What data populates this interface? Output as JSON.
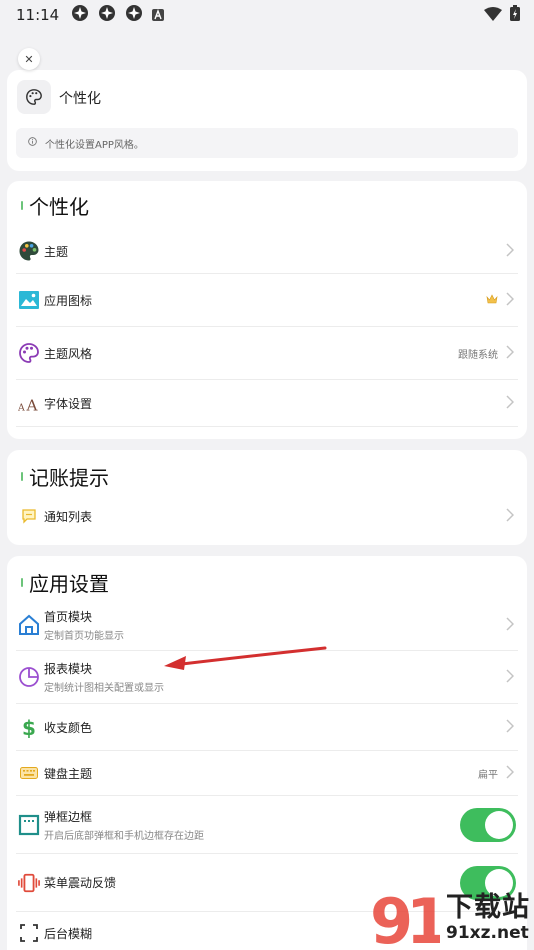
{
  "status_bar": {
    "time": "11:14"
  },
  "header": {
    "title": "个性化",
    "tip": "个性化设置APP风格。"
  },
  "sections": [
    {
      "title": "个性化",
      "items": [
        {
          "label": "主题",
          "icon": "palette-icon"
        },
        {
          "label": "应用图标",
          "icon": "image-icon",
          "badge": "crown-icon"
        },
        {
          "label": "主题风格",
          "icon": "palette-outline-icon",
          "value": "跟随系统"
        },
        {
          "label": "字体设置",
          "icon": "font-size-icon"
        }
      ]
    },
    {
      "title": "记账提示",
      "items": [
        {
          "label": "通知列表",
          "icon": "message-icon"
        }
      ]
    },
    {
      "title": "应用设置",
      "items": [
        {
          "label": "首页模块",
          "sub": "定制首页功能显示",
          "icon": "home-icon"
        },
        {
          "label": "报表模块",
          "sub": "定制统计图相关配置或显示",
          "icon": "pie-chart-icon"
        },
        {
          "label": "收支颜色",
          "icon": "dollar-icon"
        },
        {
          "label": "键盘主题",
          "icon": "keyboard-icon",
          "value": "扁平"
        },
        {
          "label": "弹框边框",
          "sub": "开启后底部弹框和手机边框存在边距",
          "icon": "frame-icon",
          "toggle": true
        },
        {
          "label": "菜单震动反馈",
          "icon": "vibrate-icon",
          "toggle": true
        },
        {
          "label": "后台模糊",
          "icon": "blur-icon"
        }
      ]
    }
  ],
  "watermark": {
    "text": "下载站",
    "site": "91xz.net"
  },
  "colors": {
    "accent_green": "#3ebd5d",
    "annotation_arrow": "#d32f2f"
  }
}
